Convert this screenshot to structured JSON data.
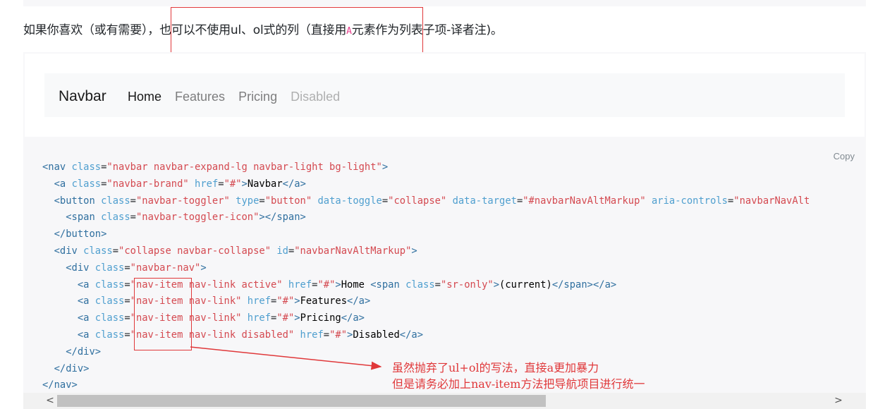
{
  "intro": {
    "text_before": "如果你喜欢（或有需要），也可以不使用ul、ol式的列（直接用",
    "code_element": "A",
    "text_after": "元素作为列表子项-译者注)。"
  },
  "example": {
    "brand": "Navbar",
    "links": [
      {
        "label": "Home",
        "state": "active"
      },
      {
        "label": "Features",
        "state": "normal"
      },
      {
        "label": "Pricing",
        "state": "normal"
      },
      {
        "label": "Disabled",
        "state": "disabled"
      }
    ]
  },
  "code": {
    "copy_label": "Copy",
    "lines": [
      "<nav class=\"navbar navbar-expand-lg navbar-light bg-light\">",
      "  <a class=\"navbar-brand\" href=\"#\">Navbar</a>",
      "  <button class=\"navbar-toggler\" type=\"button\" data-toggle=\"collapse\" data-target=\"#navbarNavAltMarkup\" aria-controls=\"navbarNavAlt",
      "    <span class=\"navbar-toggler-icon\"></span>",
      "  </button>",
      "  <div class=\"collapse navbar-collapse\" id=\"navbarNavAltMarkup\">",
      "    <div class=\"navbar-nav\">",
      "      <a class=\"nav-item nav-link active\" href=\"#\">Home <span class=\"sr-only\">(current)</span></a>",
      "      <a class=\"nav-item nav-link\" href=\"#\">Features</a>",
      "      <a class=\"nav-item nav-link\" href=\"#\">Pricing</a>",
      "      <a class=\"nav-item nav-link disabled\" href=\"#\">Disabled</a>",
      "    </div>",
      "  </div>",
      "</nav>"
    ]
  },
  "annotation": {
    "line1": "虽然抛弃了ul+ol的写法，直接a更加暴力",
    "line2": "但是请务必加上nav-item方法把导航项目进行统一",
    "color": "#e0383a"
  },
  "scrollbar": {
    "left_arrow": "<",
    "right_arrow": ">"
  },
  "colors": {
    "tag": "#2f6f9f",
    "attr": "#4f9fcf",
    "value": "#d44950",
    "code_bg": "#f7f7f9"
  }
}
